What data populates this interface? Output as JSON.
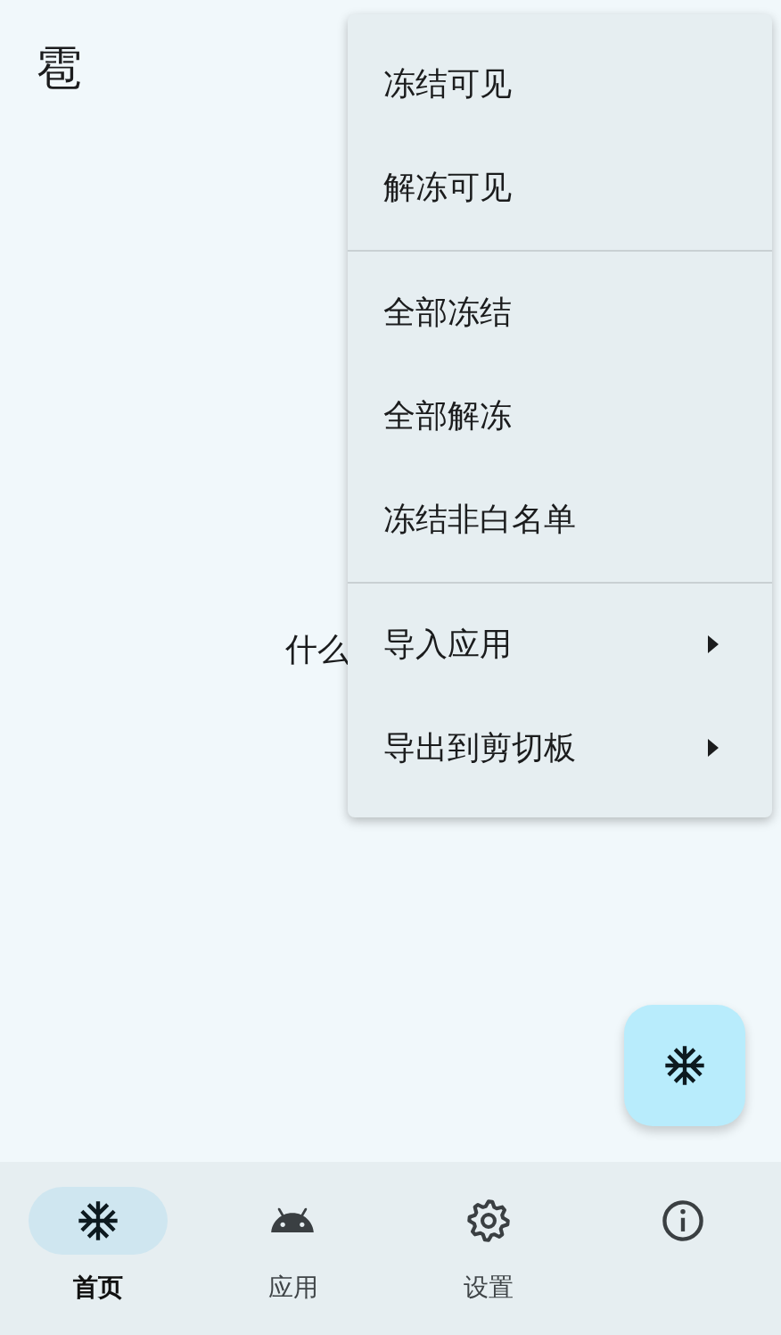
{
  "app_bar": {
    "title": "雹"
  },
  "body": {
    "text": "什么"
  },
  "menu": {
    "groups": [
      {
        "items": [
          {
            "label": "冻结可见",
            "submenu": false
          },
          {
            "label": "解冻可见",
            "submenu": false
          }
        ]
      },
      {
        "items": [
          {
            "label": "全部冻结",
            "submenu": false
          },
          {
            "label": "全部解冻",
            "submenu": false
          },
          {
            "label": "冻结非白名单",
            "submenu": false
          }
        ]
      },
      {
        "items": [
          {
            "label": "导入应用",
            "submenu": true
          },
          {
            "label": "导出到剪切板",
            "submenu": true
          }
        ]
      }
    ]
  },
  "fab": {
    "kind": "snowflake"
  },
  "bottom_nav": {
    "items": [
      {
        "kind": "snowflake",
        "label": "首页",
        "selected": true
      },
      {
        "kind": "android",
        "label": "应用",
        "selected": false
      },
      {
        "kind": "gear",
        "label": "设置",
        "selected": false
      },
      {
        "kind": "info",
        "selected": false
      }
    ]
  }
}
